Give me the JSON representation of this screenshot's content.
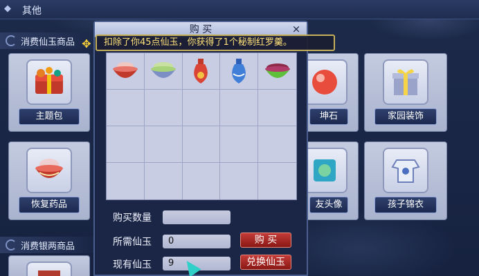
{
  "header": {
    "title": "其他",
    "icon": "diamond-icon"
  },
  "sections": {
    "jade": "消费仙玉商品",
    "silver": "消费银两商品"
  },
  "cards": {
    "zhuti": "主题包",
    "huifu": "恢复药品",
    "qiankun": "坤石",
    "toux": "友头像",
    "jiayuan": "家园装饰",
    "haizi": "孩子锦衣"
  },
  "dialog": {
    "title": "购 买",
    "close": "×",
    "items": [
      "red-pot-icon",
      "herb-bowl-icon",
      "red-vase-icon",
      "blue-vase-icon",
      "green-bowl-icon"
    ],
    "qty_label": "购买数量",
    "qty_value": "",
    "need_label": "所需仙玉",
    "need_value": "0",
    "have_label": "现有仙玉",
    "have_value": "9",
    "buy_btn": "购 买",
    "exchange_btn": "兑换仙玉"
  },
  "tooltip": "扣除了你45点仙玉，你获得了1个秘制红罗羹。",
  "colors": {
    "accent_red": "#b02a26",
    "tip_text": "#ffe27a",
    "panel": "#1b2646"
  }
}
